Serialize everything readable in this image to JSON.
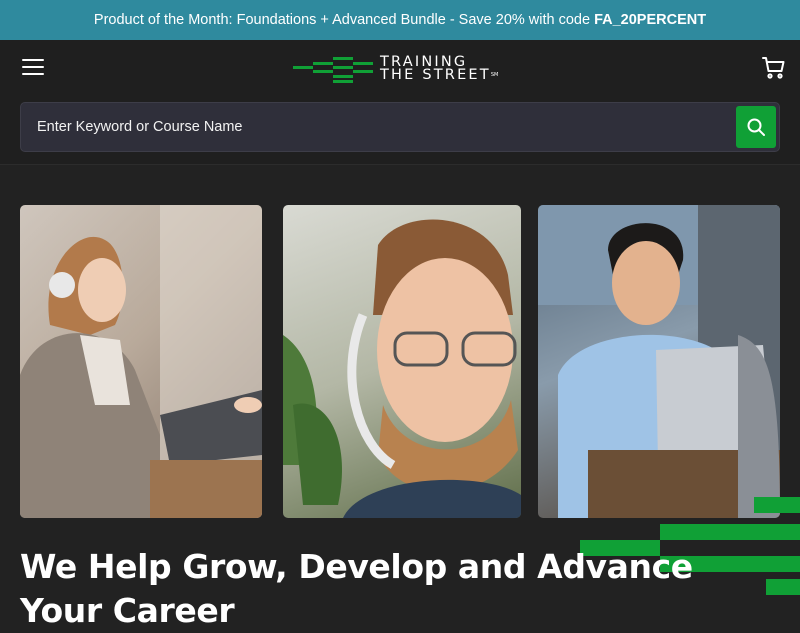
{
  "promo": {
    "text": "Product of the Month: Foundations + Advanced Bundle - Save 20% with code",
    "code": "FA_20PERCENT"
  },
  "header": {
    "logo_line1": "TRAINING",
    "logo_line2": "THE STREET",
    "logo_tm": "SM"
  },
  "search": {
    "placeholder": "Enter Keyword or Course Name"
  },
  "hero": {
    "title": "We Help Grow, Develop and Advance Your Career"
  },
  "colors": {
    "promo_bg": "#2f8a9e",
    "brand_green": "#10a036",
    "page_bg": "#222222"
  },
  "icons": [
    "menu-icon",
    "cart-icon",
    "search-icon"
  ]
}
